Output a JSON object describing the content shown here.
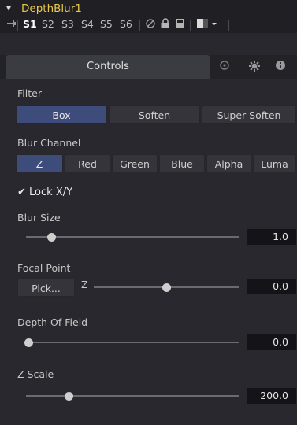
{
  "header": {
    "chevron": "▾",
    "title": "DepthBlur1"
  },
  "toolbar": {
    "pin_icon": "pin-icon",
    "slots": [
      "S1",
      "S2",
      "S3",
      "S4",
      "S5",
      "S6"
    ],
    "active_slot": "S1",
    "icons": [
      "disable-icon",
      "lock-icon",
      "save-icon",
      "color-swatch-icon"
    ]
  },
  "tabs": {
    "controls": "Controls",
    "icons": [
      "settings-icon",
      "gear-icon",
      "info-icon"
    ]
  },
  "filter": {
    "label": "Filter",
    "options": [
      "Box",
      "Soften",
      "Super Soften"
    ],
    "selected": "Box"
  },
  "blur_channel": {
    "label": "Blur Channel",
    "options": [
      "Z",
      "Red",
      "Green",
      "Blue",
      "Alpha",
      "Luma"
    ],
    "selected": "Z"
  },
  "lock": {
    "label": "Lock X/Y",
    "checked": true
  },
  "blur_size": {
    "label": "Blur Size",
    "value": "1.0",
    "slider_fraction": 0.12
  },
  "focal_point": {
    "label": "Focal Point",
    "pick_label": "Pick...",
    "z_label": "Z",
    "value": "0.0",
    "slider_fraction": 0.5
  },
  "depth_of_field": {
    "label": "Depth Of Field",
    "value": "0.0",
    "slider_fraction": 0.0
  },
  "z_scale": {
    "label": "Z Scale",
    "value": "200.0",
    "slider_fraction": 0.2
  },
  "colors": {
    "title": "#e8c84a",
    "selected_button": "#3d4c7a",
    "background": "#28282e"
  }
}
